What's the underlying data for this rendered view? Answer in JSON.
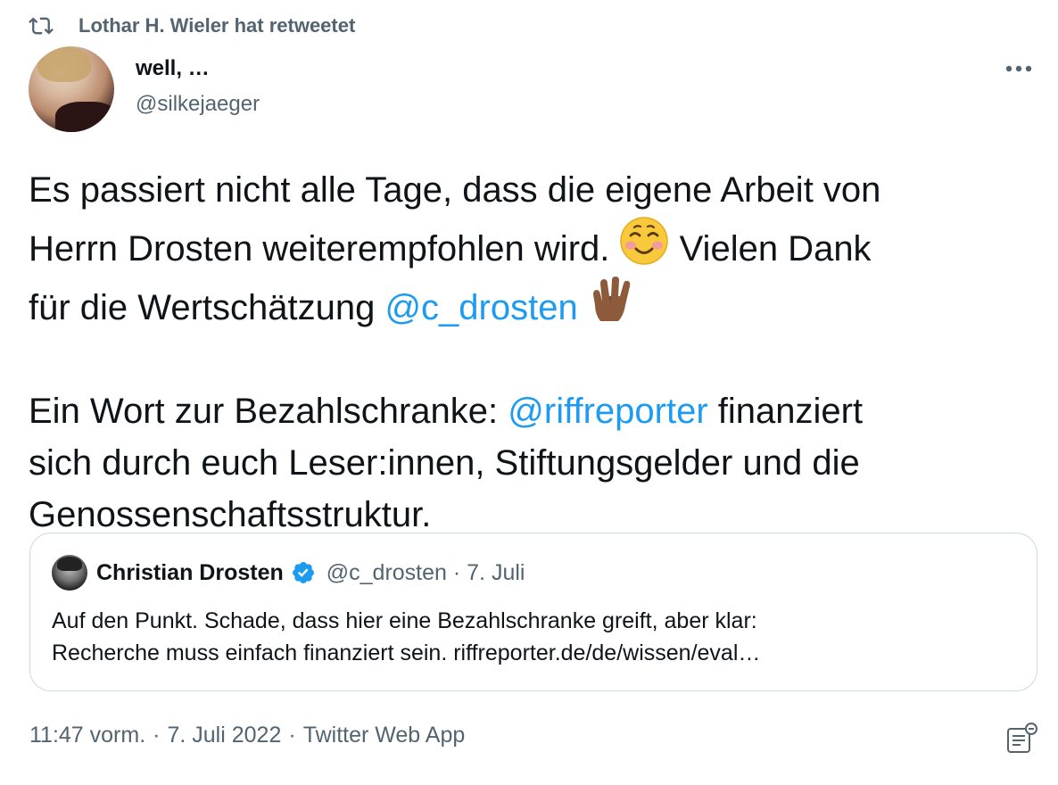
{
  "retweet": {
    "icon": "retweet-icon",
    "text": "Lothar H. Wieler hat retweetet"
  },
  "author": {
    "display_name": "well, …",
    "handle": "@silkejaeger",
    "avatar": "avatar-photo"
  },
  "more_icon": "more-icon",
  "tweet": {
    "line1": "Es passiert nicht alle Tage, dass die eigene Arbeit von",
    "line2_pre": "Herrn Drosten weiterempfohlen wird. ",
    "emoji1": "smiling-face-icon",
    "line2_post": " Vielen Dank",
    "line3_pre": "für die Wertschätzung ",
    "mention1": "@c_drosten",
    "emoji2": "vulcan-salute-icon",
    "line5_pre": "Ein Wort zur Bezahlschranke: ",
    "mention2": "@riffreporter",
    "line5_post": " finanziert",
    "line6": "sich durch euch Leser:innen, Stiftungsgelder und die",
    "line7": "Genossenschaftsstruktur."
  },
  "quote": {
    "name": "Christian Drosten",
    "verified_icon": "verified-badge-icon",
    "handle_date": "@c_drosten · 7. Juli",
    "line1": "Auf den Punkt. Schade, dass hier eine Bezahlschranke greift, aber klar:",
    "line2": "Recherche muss einfach finanziert sein. riffreporter.de/de/wissen/eval…"
  },
  "meta": {
    "time": "11:47 vorm.",
    "dot1": "·",
    "date": "7. Juli 2022",
    "dot2": "·",
    "source": "Twitter Web App"
  },
  "analytics_icon": "analytics-icon",
  "colors": {
    "text": "#0f1419",
    "secondary": "#536471",
    "link": "#1d9bf0",
    "border": "#cfd9de"
  }
}
